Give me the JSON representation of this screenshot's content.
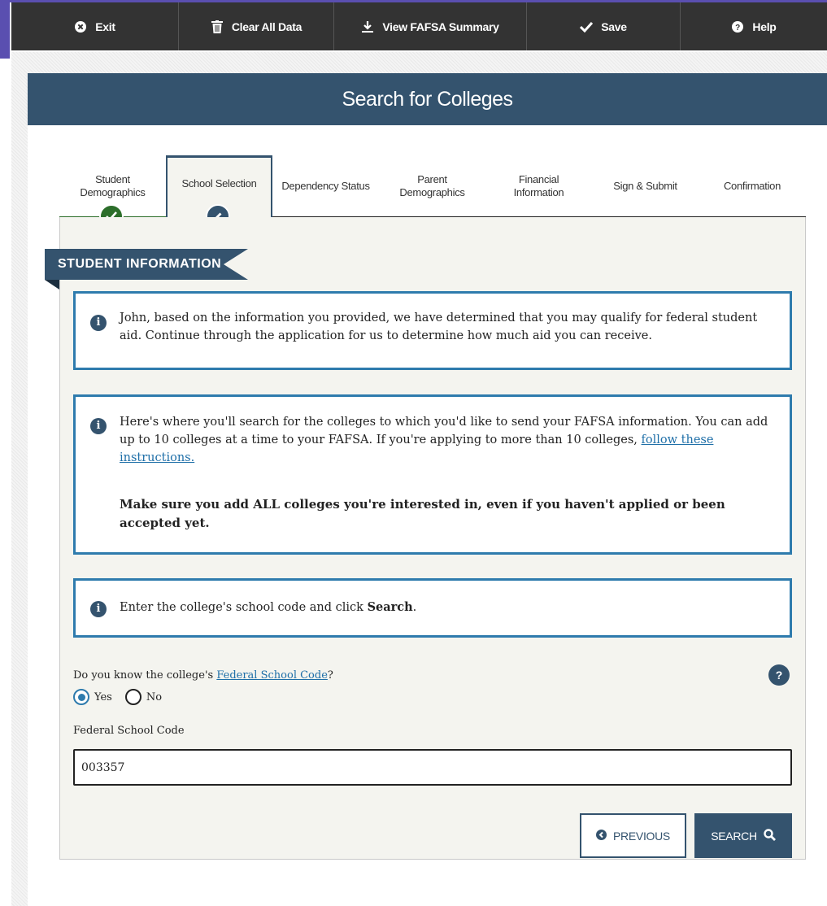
{
  "toolbar": {
    "exit": "Exit",
    "clear": "Clear All Data",
    "summary": "View FAFSA Summary",
    "save": "Save",
    "help": "Help"
  },
  "page_title": "Search for Colleges",
  "tabs": [
    {
      "line1": "Student",
      "line2": "Demographics",
      "status": "complete"
    },
    {
      "line1": "School Selection",
      "line2": "",
      "status": "active"
    },
    {
      "line1": "Dependency Status",
      "line2": "",
      "status": "pending"
    },
    {
      "line1": "Parent",
      "line2": "Demographics",
      "status": "pending"
    },
    {
      "line1": "Financial",
      "line2": "Information",
      "status": "pending"
    },
    {
      "line1": "Sign & Submit",
      "line2": "",
      "status": "pending"
    },
    {
      "line1": "Confirmation",
      "line2": "",
      "status": "pending"
    }
  ],
  "section_title": "STUDENT INFORMATION",
  "info1": "John, based on the information you provided, we have determined that you may qualify for federal student aid. Continue through the application for us to determine how much aid you can receive.",
  "info2": {
    "text": "Here's where you'll search for the colleges to which you'd like to send your FAFSA information. You can add up to 10 colleges at a time to your FAFSA. If you're applying to more than 10 colleges, ",
    "link": "follow these instructions.",
    "bold": "Make sure you add ALL colleges you're interested in, even if you haven't applied or been accepted yet."
  },
  "info3": {
    "text": "Enter the college's school code and click ",
    "bold": "Search",
    "end": "."
  },
  "question": {
    "prefix": "Do you know the college's ",
    "link": "Federal School Code",
    "suffix": "?",
    "options": [
      "Yes",
      "No"
    ],
    "selected": "Yes"
  },
  "fsc": {
    "label": "Federal School Code",
    "value": "003357"
  },
  "buttons": {
    "previous": "PREVIOUS",
    "search": "SEARCH"
  },
  "colors": {
    "navy": "#34536e",
    "green": "#2c6e2a",
    "info_border": "#2e7bad",
    "toolbar": "#333333"
  }
}
